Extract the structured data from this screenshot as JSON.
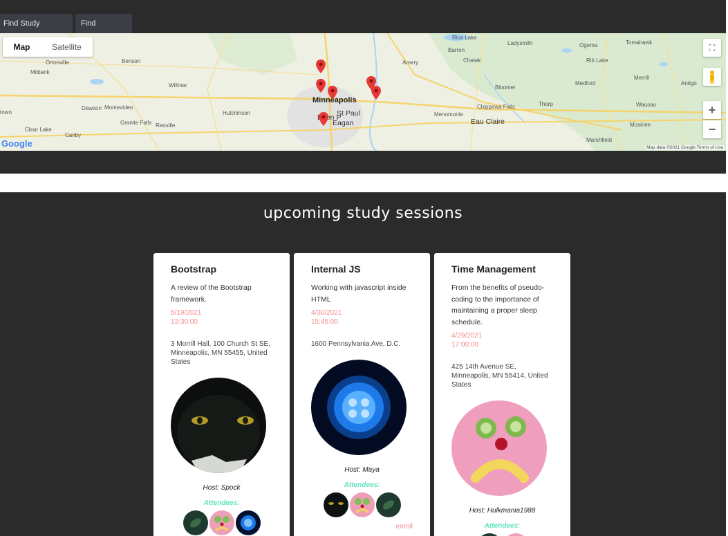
{
  "nav": {
    "tabs": [
      {
        "label": "Find Study Buddies"
      },
      {
        "label": "Find Sessions"
      }
    ]
  },
  "map": {
    "type_controls": {
      "map_label": "Map",
      "satellite_label": "Satellite",
      "selected": "Map"
    },
    "labels": {
      "ortonville": "Ortonville",
      "milbank": "Milbank",
      "benson": "Benson",
      "willmar": "Willmar",
      "hutchinson": "Hutchinson",
      "dawson": "Dawson",
      "montevideo": "Montevideo",
      "granite_falls": "Granite Falls",
      "renville": "Renville",
      "clear_lake": "Clear Lake",
      "canby": "Canby",
      "town": "town",
      "minneapolis": "Minneapolis",
      "st_paul": "St Paul",
      "eden_p": "Eden P",
      "eagan": "Eagan",
      "rice_lake": "Rice Lake",
      "barron": "Barron",
      "chetek": "Chetek",
      "amery": "Amery",
      "bloomer": "Bloomer",
      "menomonie": "Menomonie",
      "chippewa_falls": "Chippewa Falls",
      "eau_claire": "Eau Claire",
      "thorp": "Thorp",
      "ladysmith": "Ladysmith",
      "ogema": "Ogema",
      "tomahawk": "Tomahawk",
      "rib_lake": "Rib Lake",
      "medford": "Medford",
      "merrill": "Merrill",
      "antigo": "Antigo",
      "wausau": "Wausau",
      "mosinee": "Mosinee",
      "marshfield": "Marshfield"
    },
    "attribution": "Map data ©2021 Google   Terms of Use",
    "logo": "Google"
  },
  "sessions": {
    "title": "upcoming study sessions",
    "cards": [
      {
        "title": "Bootstrap",
        "description": "A review of the Bootstrap framework.",
        "date": "5/19/2021",
        "time": "13:30:00",
        "address": "3 Morrill Hall, 100 Church St SE, Minneapolis, MN 55455, United States",
        "photo": "black-cat",
        "host": "Host: Spock",
        "attendees_label": "Attendees:",
        "attendees": [
          "plant-avatar",
          "sad-fruit-face-avatar",
          "jellyfish-avatar"
        ]
      },
      {
        "title": "Internal JS",
        "description": "Working with javascript inside HTML",
        "date": "4/30/2021",
        "time": "15:45:00",
        "address": "1600 Pennsylvania Ave, D.C.",
        "photo": "jellyfish",
        "host": "Host: Maya",
        "attendees_label": "Attendees:",
        "attendees": [
          "black-cat-avatar",
          "sad-fruit-face-avatar",
          "plant-avatar"
        ],
        "enroll_label": "enroll"
      },
      {
        "title": "Time Management",
        "description": "From the benefits of pseudo-coding to the importance of maintaining a proper sleep schedule.",
        "date": "4/29/2021",
        "time": "17:00:00",
        "address": "425 14th Avenue SE, Minneapolis, MN 55414, United States",
        "photo": "sad-fruit-face",
        "host": "Host: Hulkmania1988",
        "attendees_label": "Attendees:",
        "attendees": [
          "plant-avatar",
          "sad-fruit-face-avatar"
        ]
      }
    ]
  },
  "colors": {
    "background": "#2b2b2b",
    "date_text": "#f48a8a",
    "attendees_label": "#5fe3bf",
    "nav_tab": "#3b3e45"
  }
}
